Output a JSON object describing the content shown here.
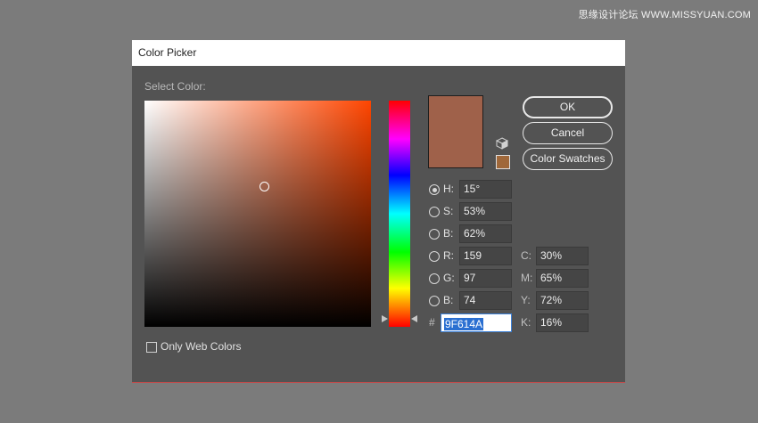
{
  "watermark": "思缘设计论坛  WWW.MISSYUAN.COM",
  "dialog": {
    "title": "Color Picker",
    "select_color_label": "Select Color:",
    "buttons": {
      "ok": "OK",
      "cancel": "Cancel",
      "color_swatches": "Color Swatches"
    },
    "preview_color": "#9f614a",
    "gamut_swatch_color": "#a0683a",
    "fields": {
      "h": {
        "label": "H:",
        "value": "15°",
        "checked": true
      },
      "s": {
        "label": "S:",
        "value": "53%"
      },
      "b": {
        "label": "B:",
        "value": "62%"
      },
      "r": {
        "label": "R:",
        "value": "159"
      },
      "g": {
        "label": "G:",
        "value": "97"
      },
      "b2": {
        "label": "B:",
        "value": "74"
      },
      "c": {
        "label": "C:",
        "value": "30%"
      },
      "m": {
        "label": "M:",
        "value": "65%"
      },
      "y": {
        "label": "Y:",
        "value": "72%"
      },
      "k": {
        "label": "K:",
        "value": "16%"
      },
      "hex": {
        "label": "#",
        "value": "9F614A"
      }
    },
    "only_web_colors_label": "Only Web Colors",
    "only_web_colors_checked": false
  }
}
